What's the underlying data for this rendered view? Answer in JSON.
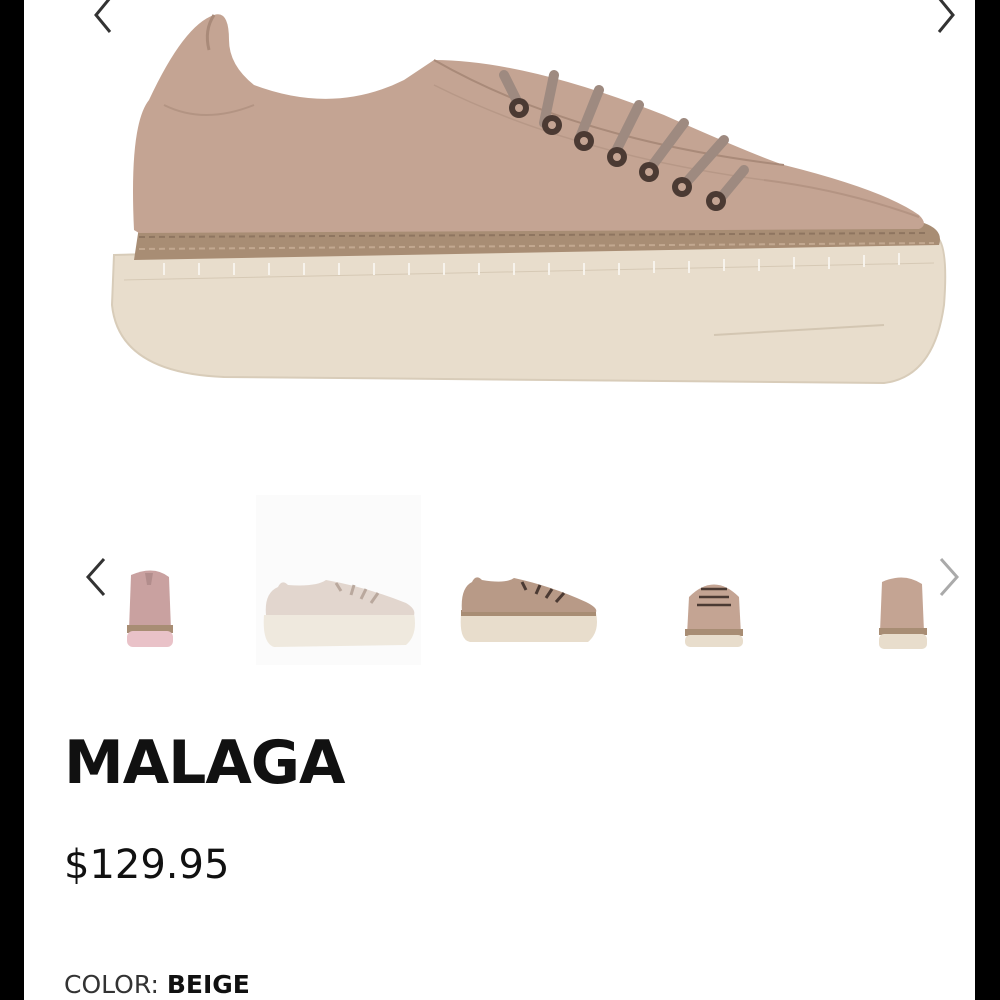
{
  "product": {
    "name": "MALAGA",
    "price": "$129.95",
    "color_label": "COLOR:",
    "color_value": "BEIGE"
  },
  "gallery": {
    "main_image": "shoe-side-view",
    "prev_icon": "chevron-left-icon",
    "next_icon": "chevron-right-icon",
    "thumbnails": [
      "shoe-back-pink",
      "shoe-side-beige",
      "shoe-side-taupe",
      "shoe-front-taupe",
      "shoe-back-taupe"
    ],
    "selected_thumbnail": 1
  },
  "colors": {
    "leather": "#c4a493",
    "sole": "#e8ddcc",
    "jute": "#a88d74",
    "laces": "#9e8a80",
    "eyelet": "#4b3a33",
    "chevron": "#333333"
  }
}
